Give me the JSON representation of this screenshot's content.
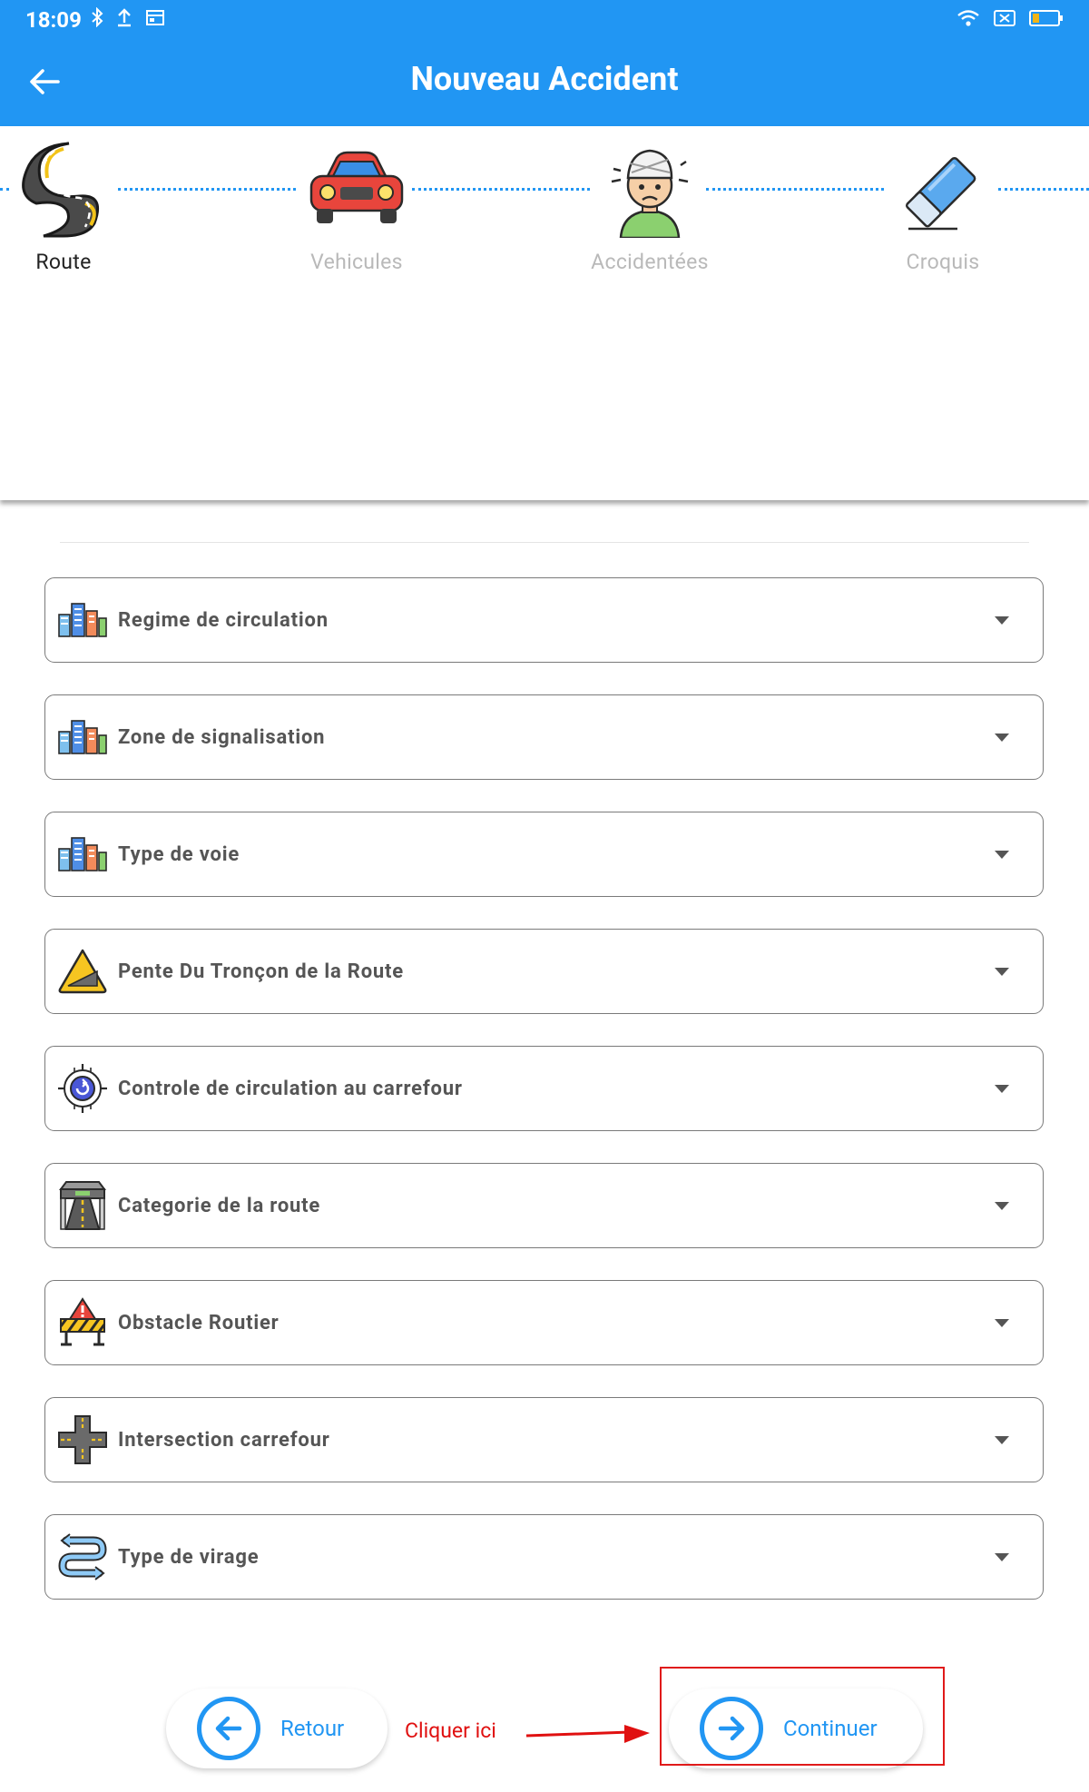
{
  "status_bar": {
    "time": "18:09"
  },
  "app_bar": {
    "title": "Nouveau Accident"
  },
  "steps": [
    {
      "label": "Route",
      "state": "active",
      "icon": "road-icon"
    },
    {
      "label": "Vehicules",
      "state": "inactive",
      "icon": "car-icon"
    },
    {
      "label": "Accidentées",
      "state": "inactive",
      "icon": "injured-person-icon"
    },
    {
      "label": "Croquis",
      "state": "inactive",
      "icon": "eraser-icon"
    }
  ],
  "fields": [
    {
      "label": "Regime de circulation",
      "icon": "city-icon"
    },
    {
      "label": "Zone de signalisation",
      "icon": "city-icon"
    },
    {
      "label": "Type de voie",
      "icon": "city-icon"
    },
    {
      "label": "Pente Du Tronçon de la Route",
      "icon": "slope-warning-icon"
    },
    {
      "label": "Controle de circulation au carrefour",
      "icon": "roundabout-icon"
    },
    {
      "label": "Categorie de la route",
      "icon": "highway-icon"
    },
    {
      "label": "Obstacle Routier",
      "icon": "roadblock-icon"
    },
    {
      "label": "Intersection carrefour",
      "icon": "intersection-icon"
    },
    {
      "label": "Type de virage",
      "icon": "curve-arrows-icon"
    }
  ],
  "buttons": {
    "back_label": "Retour",
    "continue_label": "Continuer"
  },
  "annotation": {
    "hint": "Cliquer ici"
  },
  "colors": {
    "primary": "#2196F3",
    "annotation_red": "#e01010"
  }
}
